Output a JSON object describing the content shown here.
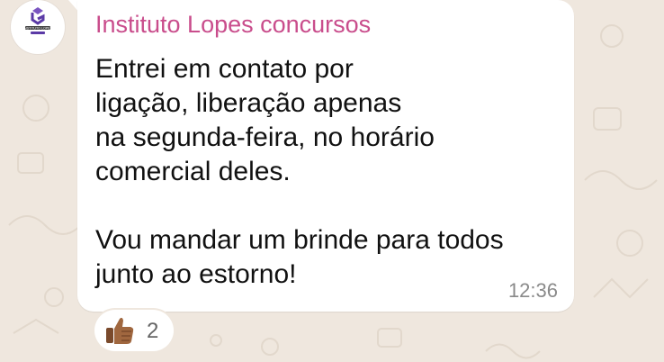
{
  "chat": {
    "avatar_icon": "instituto-lopes-logo",
    "avatar_label": "INSTITUTO LOPES",
    "sender": "Instituto Lopes concursos",
    "sender_color": "#c94d8c",
    "message_lines": [
      "Entrei em contato por",
      "ligação, liberação apenas",
      "na segunda-feira, no horário",
      "comercial deles.",
      "",
      "Vou mandar um brinde para todos",
      "junto ao estorno!"
    ],
    "time": "12:36",
    "reaction": {
      "emoji_icon": "thumbs-up-icon",
      "count": "2"
    }
  }
}
